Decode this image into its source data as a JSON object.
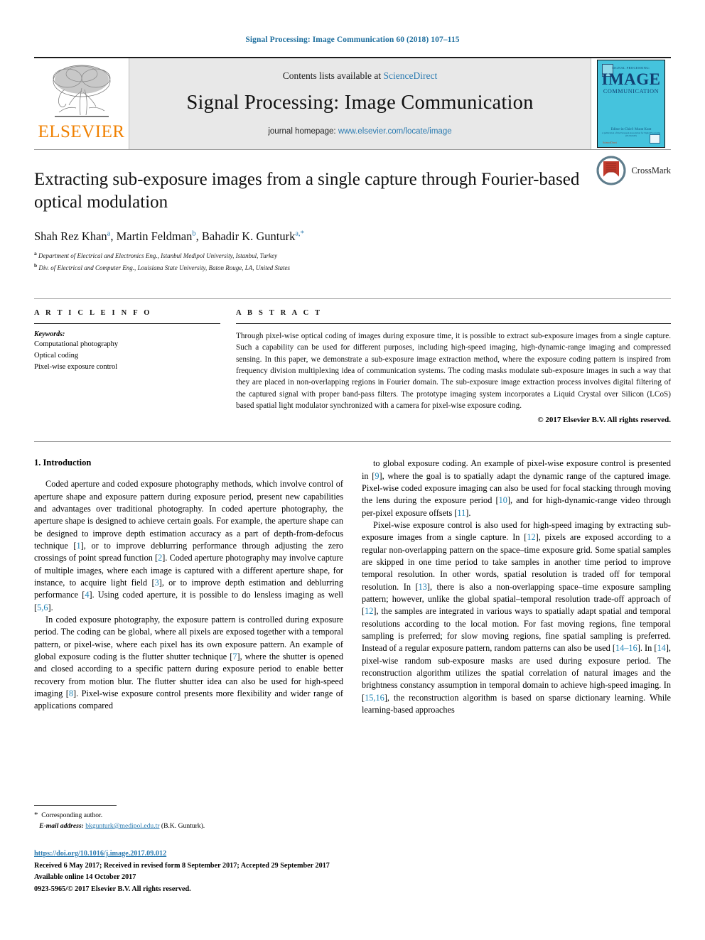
{
  "running_head": "Signal Processing: Image Communication 60 (2018) 107–115",
  "masthead": {
    "contents_prefix": "Contents lists available at ",
    "contents_link": "ScienceDirect",
    "journal_title": "Signal Processing: Image Communication",
    "homepage_prefix": "journal homepage: ",
    "homepage_link": "www.elsevier.com/locate/image",
    "publisher_logo_text": "ELSEVIER",
    "cover": {
      "kicker": "SIGNAL PROCESSING:",
      "big": "IMAGE",
      "sub": "COMMUNICATION",
      "foot": "Editor-in-Chief: Murat Kunt",
      "foot2": "A publication of the European Association for Signal Processing (EURASIP)",
      "brand": "ScienceDirect"
    }
  },
  "article": {
    "title": "Extracting sub-exposure images from a single capture through Fourier-based optical modulation",
    "crossmark_label": "CrossMark",
    "authors": [
      {
        "name": "Shah Rez Khan",
        "marks": "a"
      },
      {
        "name": "Martin Feldman",
        "marks": "b"
      },
      {
        "name": "Bahadir K. Gunturk",
        "marks": "a,*"
      }
    ],
    "affiliations": [
      {
        "mark": "a",
        "text": "Department of Electrical and Electronics Eng., Istanbul Medipol University, Istanbul, Turkey"
      },
      {
        "mark": "b",
        "text": "Div. of Electrical and Computer Eng., Louisiana State University, Baton Rouge, LA, United States"
      }
    ]
  },
  "info": {
    "heading": "A R T I C L E   I N F O",
    "keywords_label": "Keywords:",
    "keywords": [
      "Computational photography",
      "Optical coding",
      "Pixel-wise exposure control"
    ]
  },
  "abstract": {
    "heading": "A B S T R A C T",
    "text": "Through pixel-wise optical coding of images during exposure time, it is possible to extract sub-exposure images from a single capture. Such a capability can be used for different purposes, including high-speed imaging, high-dynamic-range imaging and compressed sensing. In this paper, we demonstrate a sub-exposure image extraction method, where the exposure coding pattern is inspired from frequency division multiplexing idea of communication systems. The coding masks modulate sub-exposure images in such a way that they are placed in non-overlapping regions in Fourier domain. The sub-exposure image extraction process involves digital filtering of the captured signal with proper band-pass filters. The prototype imaging system incorporates a Liquid Crystal over Silicon (LCoS) based spatial light modulator synchronized with a camera for pixel-wise exposure coding.",
    "copyright": "© 2017 Elsevier B.V. All rights reserved."
  },
  "body": {
    "section_title": "1.  Introduction",
    "left_paragraphs": [
      "Coded aperture and coded exposure photography methods, which involve control of aperture shape and exposure pattern during exposure period, present new capabilities and advantages over traditional photography. In coded aperture photography, the aperture shape is designed to achieve certain goals. For example, the aperture shape can be designed to improve depth estimation accuracy as a part of depth-from-defocus technique [1], or to improve deblurring performance through adjusting the zero crossings of point spread function [2]. Coded aperture photography may involve capture of multiple images, where each image is captured with a different aperture shape, for instance, to acquire light field [3], or to improve depth estimation and deblurring performance [4]. Using coded aperture, it is possible to do lensless imaging as well [5,6].",
      "In coded exposure photography, the exposure pattern is controlled during exposure period. The coding can be global, where all pixels are exposed together with a temporal pattern, or pixel-wise, where each pixel has its own exposure pattern. An example of global exposure coding is the flutter shutter technique [7], where the shutter is opened and closed according to a specific pattern during exposure period to enable better recovery from motion blur. The flutter shutter idea can also be used for high-speed imaging [8]. Pixel-wise exposure control presents more flexibility and wider range of applications compared"
    ],
    "right_paragraphs": [
      "to global exposure coding. An example of pixel-wise exposure control is presented in [9], where the goal is to spatially adapt the dynamic range of the captured image. Pixel-wise coded exposure imaging can also be used for focal stacking through moving the lens during the exposure period [10], and for high-dynamic-range video through per-pixel exposure offsets [11].",
      "Pixel-wise exposure control is also used for high-speed imaging by extracting sub-exposure images from a single capture. In [12], pixels are exposed according to a regular non-overlapping pattern on the space–time exposure grid. Some spatial samples are skipped in one time period to take samples in another time period to improve temporal resolution. In other words, spatial resolution is traded off for temporal resolution. In [13], there is also a non-overlapping space–time exposure sampling pattern; however, unlike the global spatial–temporal resolution trade-off approach of [12], the samples are integrated in various ways to spatially adapt spatial and temporal resolutions according to the local motion. For fast moving regions, fine temporal sampling is preferred; for slow moving regions, fine spatial sampling is preferred. Instead of a regular exposure pattern, random patterns can also be used [14–16]. In [14], pixel-wise random sub-exposure masks are used during exposure period. The reconstruction algorithm utilizes the spatial correlation of natural images and the brightness constancy assumption in temporal domain to achieve high-speed imaging. In [15,16], the reconstruction algorithm is based on sparse dictionary learning. While learning-based approaches"
    ]
  },
  "footnotes": {
    "corresponding": "Corresponding author.",
    "email_label": "E-mail address:",
    "email": "bkgunturk@medipol.edu.tr",
    "email_suffix": "(B.K. Gunturk)."
  },
  "publication_footer": {
    "doi": "https://doi.org/10.1016/j.image.2017.09.012",
    "history": "Received 6 May 2017; Received in revised form 8 September 2017; Accepted 29 September 2017",
    "online": "Available online 14 October 2017",
    "issn_line": "0923-5965/© 2017 Elsevier B.V. All rights reserved."
  },
  "colors": {
    "link": "#2a7ab0",
    "running_head": "#1f6f9e",
    "elsevier_orange": "#f08000",
    "reference": "#1f84b5",
    "cover_bg": "#45c3dd"
  }
}
